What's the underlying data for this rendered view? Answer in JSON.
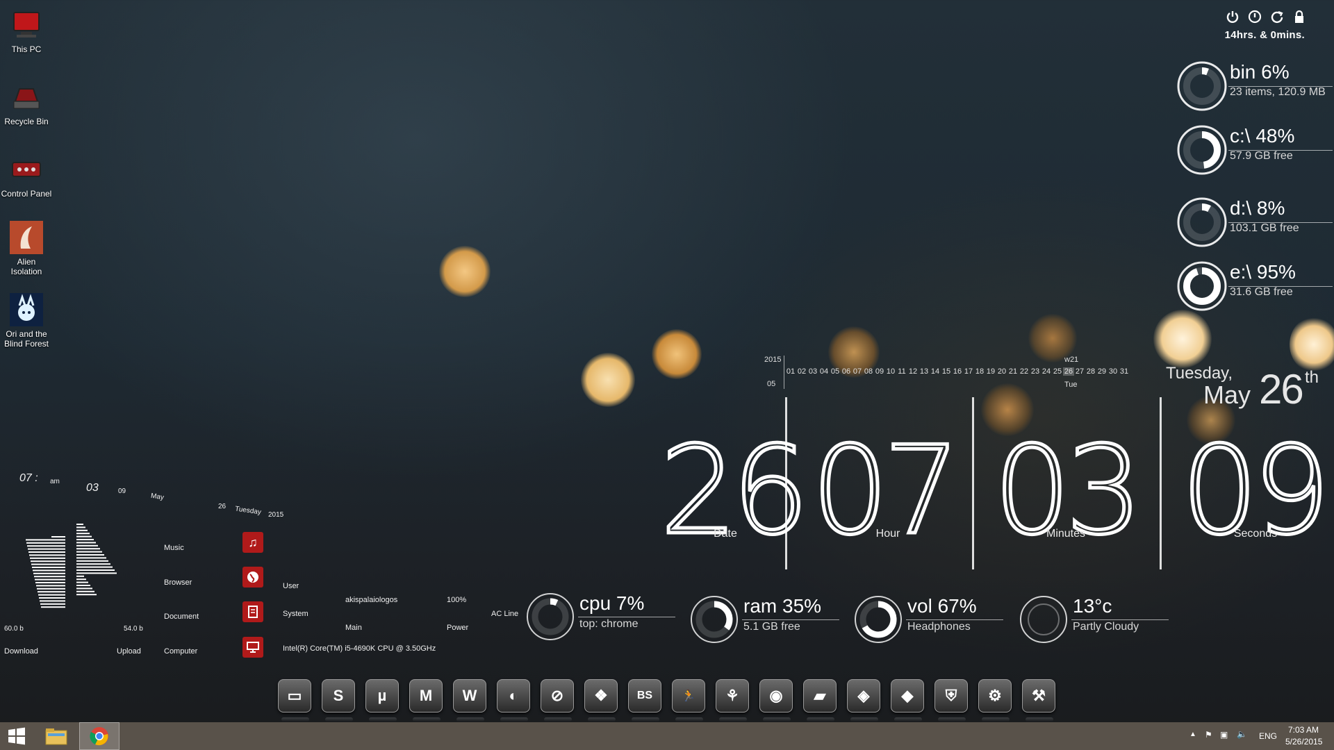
{
  "desktop": {
    "icons": [
      {
        "label": "This PC",
        "icon": "this-pc-icon"
      },
      {
        "label": "Recycle Bin",
        "icon": "recycle-bin-icon"
      },
      {
        "label": "Control Panel",
        "icon": "control-panel-icon"
      },
      {
        "label": "Alien\nIsolation",
        "label1": "Alien",
        "label2": "Isolation",
        "icon": "alien-isolation-icon"
      },
      {
        "label1": "Ori and the",
        "label2": "Blind Forest",
        "icon": "ori-icon"
      }
    ]
  },
  "power": {
    "icons": [
      "power-icon",
      "shutdown-icon",
      "restart-icon",
      "lock-icon"
    ],
    "uptime": "14hrs. & 0mins."
  },
  "rings": [
    {
      "title": "bin 6%",
      "sub": "23 items, 120.9 MB",
      "percent": 6
    },
    {
      "title": "c:\\ 48%",
      "sub": "57.9 GB free",
      "percent": 48
    },
    {
      "title": "d:\\ 8%",
      "sub": "103.1 GB free",
      "percent": 8
    },
    {
      "title": "e:\\ 95%",
      "sub": "31.6 GB free",
      "percent": 95
    }
  ],
  "calendar": {
    "year": "2015",
    "month": "05",
    "week": "w21",
    "weekday_short": "Tue",
    "days": [
      "01",
      "02",
      "03",
      "04",
      "05",
      "06",
      "07",
      "08",
      "09",
      "10",
      "11",
      "12",
      "13",
      "14",
      "15",
      "16",
      "17",
      "18",
      "19",
      "20",
      "21",
      "22",
      "23",
      "24",
      "25",
      "26",
      "27",
      "28",
      "29",
      "30",
      "31"
    ],
    "today": "26"
  },
  "date_words": {
    "weekday": "Tuesday,",
    "month": "May",
    "day": "26",
    "suffix": "th"
  },
  "clock": {
    "date": "26",
    "date_label": "Date",
    "hour": "07",
    "hour_label": "Hour",
    "minutes": "03",
    "minutes_label": "Minutes",
    "seconds": "09",
    "seconds_label": "Seconds"
  },
  "bottom_rings": [
    {
      "title": "cpu 7%",
      "sub": "top: chrome",
      "percent": 7
    },
    {
      "title": "ram 35%",
      "sub": "5.1 GB free",
      "percent": 35
    },
    {
      "title": "vol 67%",
      "sub": "Headphones",
      "percent": 67
    },
    {
      "title": "13°c",
      "sub": "Partly Cloudy",
      "percent": 0
    }
  ],
  "small_clock": {
    "hour": "07 :",
    "ampm": "am",
    "minute": "03",
    "second": "09",
    "month": "May",
    "day": "26",
    "weekday": "Tuesday",
    "year": "2015"
  },
  "network": {
    "download_value": "60.0 b",
    "upload_value": "54.0 b",
    "download_label": "Download",
    "upload_label": "Upload"
  },
  "launcher": {
    "items": [
      "Music",
      "Browser",
      "Document",
      "Computer"
    ]
  },
  "sysinfo": {
    "user_label": "User",
    "user_value": "akispalaiologos",
    "system_label": "System",
    "system_value": "Main",
    "cpu_value": "Intel(R) Core(TM) i5-4690K CPU @ 3.50GHz",
    "battery_value": "100%",
    "power_label": "Power",
    "ac_label": "AC Line"
  },
  "dock": {
    "items": [
      {
        "icon": "monitor-icon",
        "glyph": "▭"
      },
      {
        "icon": "skype-icon",
        "glyph": "S"
      },
      {
        "icon": "utorrent-icon",
        "glyph": "µ"
      },
      {
        "icon": "m-app-icon",
        "glyph": "M"
      },
      {
        "icon": "wordpress-icon",
        "glyph": "W"
      },
      {
        "icon": "steam-icon",
        "glyph": "◐"
      },
      {
        "icon": "no-sign-icon",
        "glyph": "⊘"
      },
      {
        "icon": "media-icon",
        "glyph": "❖"
      },
      {
        "icon": "bs-icon",
        "glyph": "BS"
      },
      {
        "icon": "runner-icon",
        "glyph": "🏃"
      },
      {
        "icon": "acrobat-icon",
        "glyph": "⚘"
      },
      {
        "icon": "globe-icon",
        "glyph": "◉"
      },
      {
        "icon": "drive-icon",
        "glyph": "▰"
      },
      {
        "icon": "network-icon",
        "glyph": "◈"
      },
      {
        "icon": "hardware-icon",
        "glyph": "◆"
      },
      {
        "icon": "shield-icon",
        "glyph": "⛨"
      },
      {
        "icon": "settings-icon",
        "glyph": "⚙"
      },
      {
        "icon": "tools-icon",
        "glyph": "⚒"
      }
    ]
  },
  "taskbar": {
    "tray": {
      "lang": "ENG",
      "time": "7:03 AM",
      "date": "5/26/2015"
    },
    "apps": [
      "start-icon",
      "file-explorer-icon",
      "chrome-icon"
    ]
  }
}
